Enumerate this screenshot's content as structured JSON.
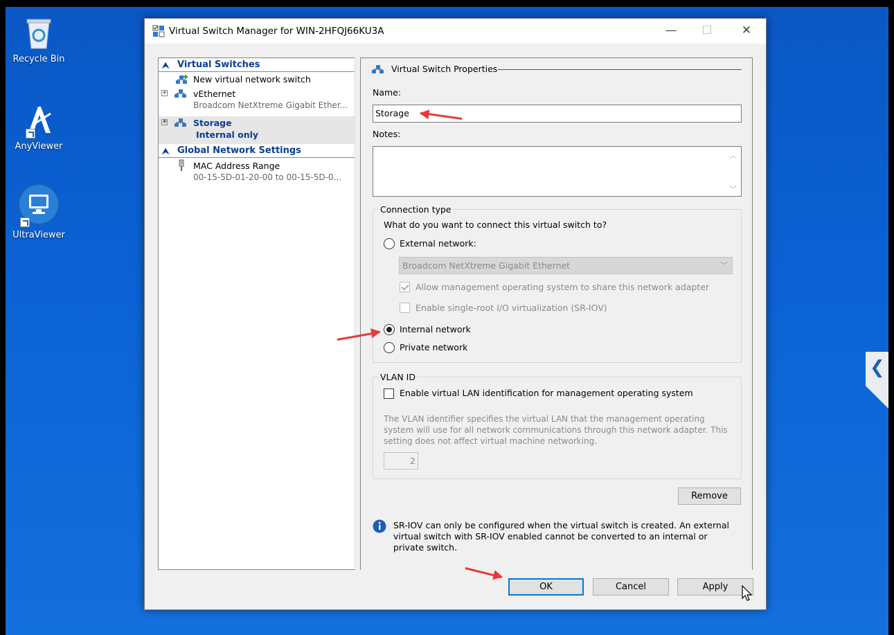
{
  "desktop": {
    "icons": [
      {
        "label": "Recycle Bin"
      },
      {
        "label": "AnyViewer"
      },
      {
        "label": "UltraViewer"
      }
    ],
    "side_tab_glyph": "❮"
  },
  "window": {
    "title": "Virtual Switch Manager for WIN-2HFQJ66KU3A",
    "controls": {
      "minimize": "—",
      "maximize": "☐",
      "close": "✕"
    }
  },
  "tree": {
    "virtual_switches_header": "Virtual Switches",
    "new_switch": "New virtual network switch",
    "vethernet": {
      "name": "vEthernet",
      "sub": "Broadcom NetXtreme Gigabit Ether..."
    },
    "storage": {
      "name": "Storage",
      "sub": "Internal only"
    },
    "global_header": "Global Network Settings",
    "mac_range": {
      "name": "MAC Address Range",
      "sub": "00-15-5D-01-20-00 to 00-15-5D-0..."
    }
  },
  "properties": {
    "section_title": "Virtual Switch Properties",
    "name_label": "Name:",
    "name_value": "Storage",
    "notes_label": "Notes:",
    "notes_value": "",
    "connection": {
      "title": "Connection type",
      "question": "What do you want to connect this virtual switch to?",
      "external_label": "External network:",
      "adapter_value": "Broadcom NetXtreme Gigabit Ethernet",
      "allow_mgmt_label": "Allow management operating system to share this network adapter",
      "sriov_label": "Enable single-root I/O virtualization (SR-IOV)",
      "internal_label": "Internal network",
      "private_label": "Private network",
      "selected": "internal"
    },
    "vlan": {
      "title": "VLAN ID",
      "enable_label": "Enable virtual LAN identification for management operating system",
      "description": "The VLAN identifier specifies the virtual LAN that the management operating system will use for all network communications through this network adapter. This setting does not affect virtual machine networking.",
      "value": "2"
    },
    "remove_label": "Remove",
    "info_text": "SR-IOV can only be configured when the virtual switch is created. An external virtual switch with SR-IOV enabled cannot be converted to an internal or private switch."
  },
  "footer": {
    "ok_label": "OK",
    "cancel_label": "Cancel",
    "apply_label": "Apply"
  },
  "colors": {
    "desktop": "#0b62d4",
    "header_text": "#0a3d91",
    "annotation_arrow": "#e8393a",
    "default_button_border": "#0078d7"
  }
}
